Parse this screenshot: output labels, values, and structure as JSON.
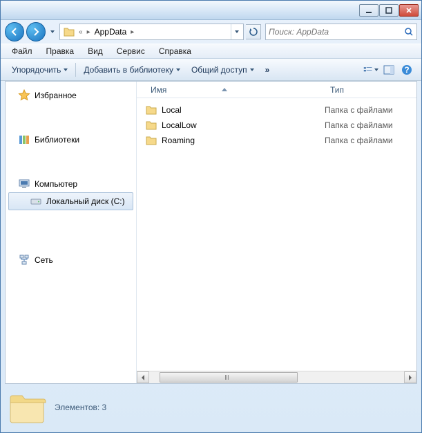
{
  "titlebar": {},
  "nav": {
    "breadcrumb_segment": "AppData",
    "refresh_title": "Обновить"
  },
  "search": {
    "placeholder": "Поиск: AppData"
  },
  "menubar": {
    "file": "Файл",
    "edit": "Правка",
    "view": "Вид",
    "tools": "Сервис",
    "help": "Справка"
  },
  "toolbar": {
    "organize": "Упорядочить",
    "add_to_library": "Добавить в библиотеку",
    "share": "Общий доступ",
    "overflow": "»"
  },
  "sidebar": {
    "favorites": "Избранное",
    "libraries": "Библиотеки",
    "computer": "Компьютер",
    "local_disk": "Локальный диск (C:)",
    "network": "Сеть"
  },
  "columns": {
    "name": "Имя",
    "type": "Тип"
  },
  "files": [
    {
      "name": "Local",
      "type": "Папка с файлами"
    },
    {
      "name": "LocalLow",
      "type": "Папка с файлами"
    },
    {
      "name": "Roaming",
      "type": "Папка с файлами"
    }
  ],
  "details": {
    "count_label": "Элементов: 3"
  }
}
